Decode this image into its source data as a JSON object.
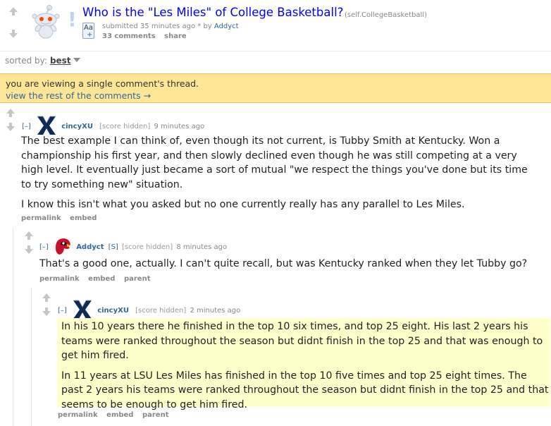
{
  "post": {
    "title": "Who is the \"Les Miles\" of College Basketball?",
    "domain": "(self.CollegeBasketball)",
    "self_mark": "!",
    "expando_label": "Aa",
    "expando_plus": "+",
    "tagline_prefix": "submitted 35 minutes ago * by ",
    "author": "Addyct",
    "comments_label": "33 comments",
    "share_label": "share"
  },
  "sort": {
    "label": "sorted by:",
    "value": "best"
  },
  "notice": {
    "text": "you are viewing a single comment's thread.",
    "link": "view the rest of the comments →"
  },
  "comments": [
    {
      "toggle": "[–]",
      "author": "cincyXU",
      "flair_icon": "xavier-x-icon",
      "score": "[score hidden]",
      "age": "9 minutes ago",
      "paragraphs": [
        "The best example I can think of, even though its not current, is Tubby Smith at Kentucky. Won a championship his first year, and then slowly declined even though he was still competing at a very high level. It eventually just became a sort of mutual \"we respect the things you've done but its time to try something new\" situation.",
        "I know this isn't what you asked but no one currently really has any parallel to Les Miles."
      ],
      "buttons": [
        "permalink",
        "embed"
      ]
    },
    {
      "toggle": "[–]",
      "author": "Addyct",
      "flair_icon": "louisville-cardinal-icon",
      "submitter": "[S]",
      "score": "[score hidden]",
      "age": "8 minutes ago",
      "paragraphs": [
        "That's a good one, actually. I can't quite recall, but was Kentucky ranked when they let Tubby go?"
      ],
      "buttons": [
        "permalink",
        "embed",
        "parent"
      ]
    },
    {
      "toggle": "[–]",
      "author": "cincyXU",
      "flair_icon": "xavier-x-icon",
      "score": "[score hidden]",
      "age": "2 minutes ago",
      "paragraphs": [
        "In his 10 years there he finished in the top 10 six times, and top 25 eight. His last 2 years his teams were ranked throughout the season but didnt finish in the top 25 and that was enough to get him fired.",
        "In 11 years at LSU Les Miles has finished in the top 10 five times and top 25 eight times. The past 2 years his teams were ranked throughout the season but didnt finish in the top 25 and that seems to be enough to get him fired."
      ],
      "buttons": [
        "permalink",
        "embed",
        "parent"
      ],
      "highlight_color": "#ffffcc"
    }
  ],
  "colors": {
    "link": "#369",
    "title": "#0000ff",
    "notice_bg": "#ffe596",
    "highlight": "#ffffcc",
    "xavier_navy": "#0c2c56",
    "cardinal_red": "#c8102e"
  }
}
